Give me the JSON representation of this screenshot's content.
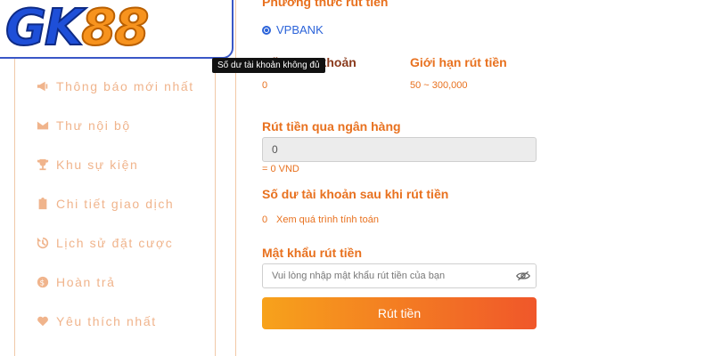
{
  "logo": {
    "gk": "GK",
    "num": "88"
  },
  "sidebar": {
    "items": [
      {
        "label": "Thông báo mới nhất",
        "icon": "megaphone-icon"
      },
      {
        "label": "Thư nội bộ",
        "icon": "envelope-icon"
      },
      {
        "label": "Khu sự kiện",
        "icon": "trophy-icon"
      },
      {
        "label": "Chi tiết giao dịch",
        "icon": "clipboard-icon"
      },
      {
        "label": "Lịch sử đặt cược",
        "icon": "history-icon"
      },
      {
        "label": "Hoàn trả",
        "icon": "dollar-coin-icon"
      },
      {
        "label": "Yêu thích nhất",
        "icon": "heart-icon"
      }
    ]
  },
  "withdraw": {
    "method_title": "Phương thức rút tiền",
    "method_option": "VPBANK",
    "tooltip": "Số dư tài khoản không đủ",
    "balance_label": "Số dư tài khoản",
    "balance_value": "0",
    "limit_label": "Giới hạn rút tiền",
    "limit_value": "50 ~ 300,000",
    "bank_label": "Rút tiền qua ngân hàng",
    "amount_value": "0",
    "amount_converted": "= 0 VND",
    "after_label": "Số dư tài khoản sau khi rút tiền",
    "after_value": "0",
    "calc_link": "Xem quá trình tính toán",
    "password_label": "Mật khẩu rút tiền",
    "password_placeholder": "Vui lòng nhập mật khẩu rút tiền của bạn",
    "submit_label": "Rút tiền"
  },
  "colors": {
    "accent": "#e8711f",
    "brand_blue": "#1e4fd8",
    "brand_orange": "#f7931e",
    "sidebar_text": "#f0b48c"
  }
}
